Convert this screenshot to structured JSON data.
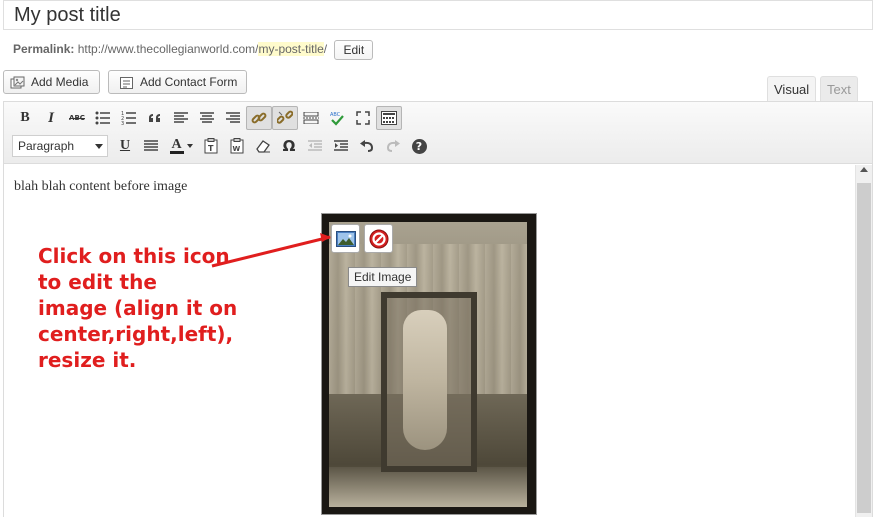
{
  "post": {
    "title": "My post title"
  },
  "permalink": {
    "label": "Permalink:",
    "base_url": "http://www.thecollegianworld.com/",
    "slug": "my-post-title",
    "trailing": "/",
    "edit_label": "Edit"
  },
  "media_buttons": {
    "add_media": "Add Media",
    "add_contact_form": "Add Contact Form"
  },
  "editor_tabs": {
    "visual": "Visual",
    "text": "Text",
    "active": "Visual"
  },
  "toolbar": {
    "row1": [
      "bold",
      "italic",
      "strikethrough",
      "bulleted-list",
      "numbered-list",
      "blockquote",
      "align-left",
      "align-center",
      "align-right",
      "insert-link",
      "remove-link",
      "insert-more",
      "spellcheck",
      "fullscreen",
      "toolbar-toggle"
    ],
    "bold_glyph": "B",
    "italic_glyph": "I",
    "strike_glyph": "ABC",
    "format_value": "Paragraph",
    "underline_glyph": "U",
    "textcolor_glyph": "A",
    "charmap_glyph": "Ω",
    "help_glyph": "?"
  },
  "content": {
    "text": "blah blah content before image"
  },
  "image_overlay": {
    "tooltip": "Edit Image"
  },
  "annotation": {
    "text": "Click on this icon\nto edit the\nimage (align it on\ncenter,right,left),\nresize it.",
    "color": "#e01e1e"
  }
}
